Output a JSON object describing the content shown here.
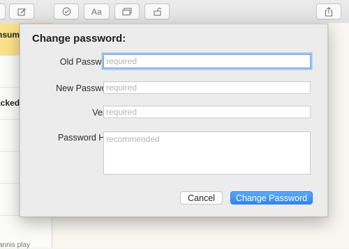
{
  "toolbar": {
    "buttons": [
      {
        "icon": "compose-icon"
      },
      {
        "icon": "checklist-icon"
      },
      {
        "icon": "format-icon",
        "label": "Aa"
      },
      {
        "icon": "table-icon"
      },
      {
        "icon": "lock-icon"
      },
      {
        "icon": "share-icon"
      }
    ]
  },
  "sidebar": {
    "notes": [
      {
        "title": "nsum",
        "selected": true
      },
      {
        "title": "acked",
        "selected": false
      },
      {
        "title": "annis play",
        "selected": false
      }
    ]
  },
  "dialog": {
    "title": "Change password:",
    "fields": {
      "old_password": {
        "label": "Old Password:",
        "placeholder": "required",
        "value": ""
      },
      "new_password": {
        "label": "New Password:",
        "placeholder": "required",
        "value": ""
      },
      "verify": {
        "label": "Verify:",
        "placeholder": "required",
        "value": ""
      },
      "hint": {
        "label": "Password Hint:",
        "placeholder": "recommended",
        "value": ""
      }
    },
    "buttons": {
      "cancel": "Cancel",
      "confirm": "Change Password"
    }
  },
  "colors": {
    "accent": "#2f86f1",
    "selected_note": "#fbe28a",
    "focus_ring": "#9ebff0"
  }
}
